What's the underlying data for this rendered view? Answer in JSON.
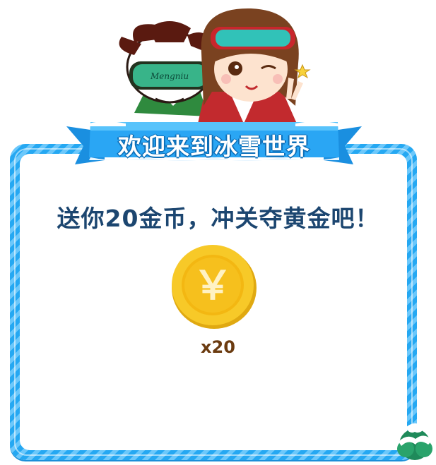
{
  "dialog": {
    "title": "欢迎来到冰雪世界",
    "message": "送你20金币，冲关夺黄金吧！",
    "reward_count": "x20",
    "goggle_text": "Mengniu",
    "coin_symbol": "￥"
  },
  "colors": {
    "frame_blue": "#25a8f2",
    "message_text": "#1c4670",
    "coin_gold": "#f5c518",
    "count_brown": "#6b3b10"
  },
  "icons": [
    "coin-icon",
    "winter-tree-icon",
    "cow-mascot",
    "girl-mascot"
  ]
}
